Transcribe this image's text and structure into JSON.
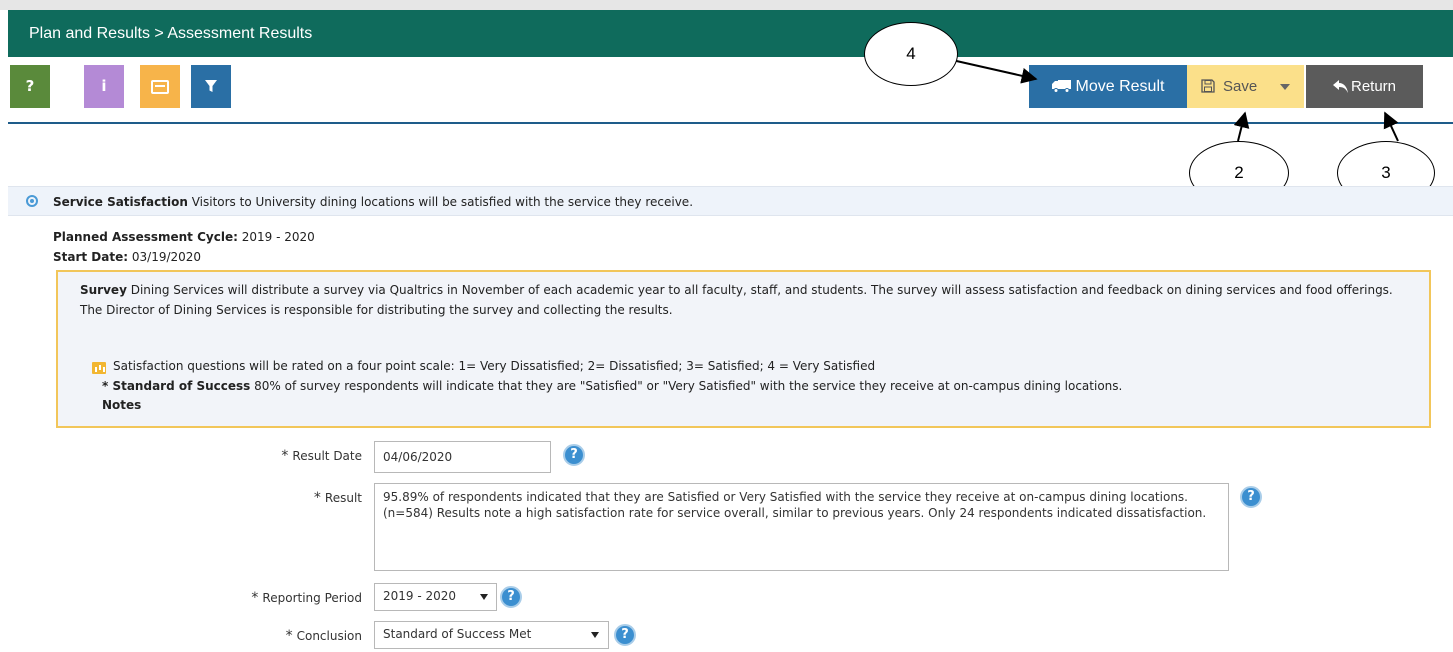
{
  "header": {
    "breadcrumb": "Plan and Results > Assessment Results"
  },
  "toolbar": {
    "help_label": "?",
    "info_label": "i",
    "move_result_label": "Move Result",
    "save_label": "Save",
    "return_label": "Return",
    "icons": {
      "help": "help-icon",
      "info": "info-icon",
      "notes": "notes-icon",
      "filter": "filter-icon",
      "move": "truck-icon",
      "save": "floppy-icon",
      "return": "reply-arrow-icon"
    }
  },
  "callouts": [
    "4",
    "2",
    "3"
  ],
  "outcome": {
    "title": "Service Satisfaction",
    "description": "Visitors to University dining locations will be satisfied with the service they receive."
  },
  "meta": {
    "cycle_label": "Planned Assessment Cycle:",
    "cycle_value": "2019 - 2020",
    "start_label": "Start Date:",
    "start_value": "03/19/2020"
  },
  "survey": {
    "title": "Survey",
    "description": "Dining Services will distribute a survey via Qualtrics in November of each academic year to all faculty, staff, and students. The survey will assess satisfaction and feedback on dining services and food offerings. The Director of Dining Services is responsible for distributing the survey and collecting the results.",
    "scale": "Satisfaction questions will be rated on a four point scale: 1= Very Dissatisfied; 2= Dissatisfied; 3= Satisfied; 4 = Very Satisfied",
    "standard_label": "* Standard of Success",
    "standard_text": "80% of survey respondents will indicate that they are \"Satisfied\" or \"Very Satisfied\" with the service they receive at on-campus dining locations.",
    "notes_label": "Notes"
  },
  "form": {
    "result_date_label": "Result Date",
    "result_date_value": "04/06/2020",
    "result_label": "Result",
    "result_value": "95.89% of respondents indicated that they are Satisfied or Very Satisfied with the service they receive at on-campus dining locations. (n=584) Results note a high satisfaction rate for service overall, similar to previous years. Only 24 respondents indicated dissatisfaction.",
    "reporting_period_label": "Reporting Period",
    "reporting_period_value": "2019 - 2020",
    "conclusion_label": "Conclusion",
    "conclusion_value": "Standard of Success Met",
    "required_marker": "*",
    "help_glyph": "?"
  },
  "colors": {
    "header_bg": "#0f6b5c",
    "move_btn": "#2a6fa5",
    "save_btn": "#fbe08a",
    "return_btn": "#5b5b5b",
    "survey_border": "#f2c65a"
  }
}
